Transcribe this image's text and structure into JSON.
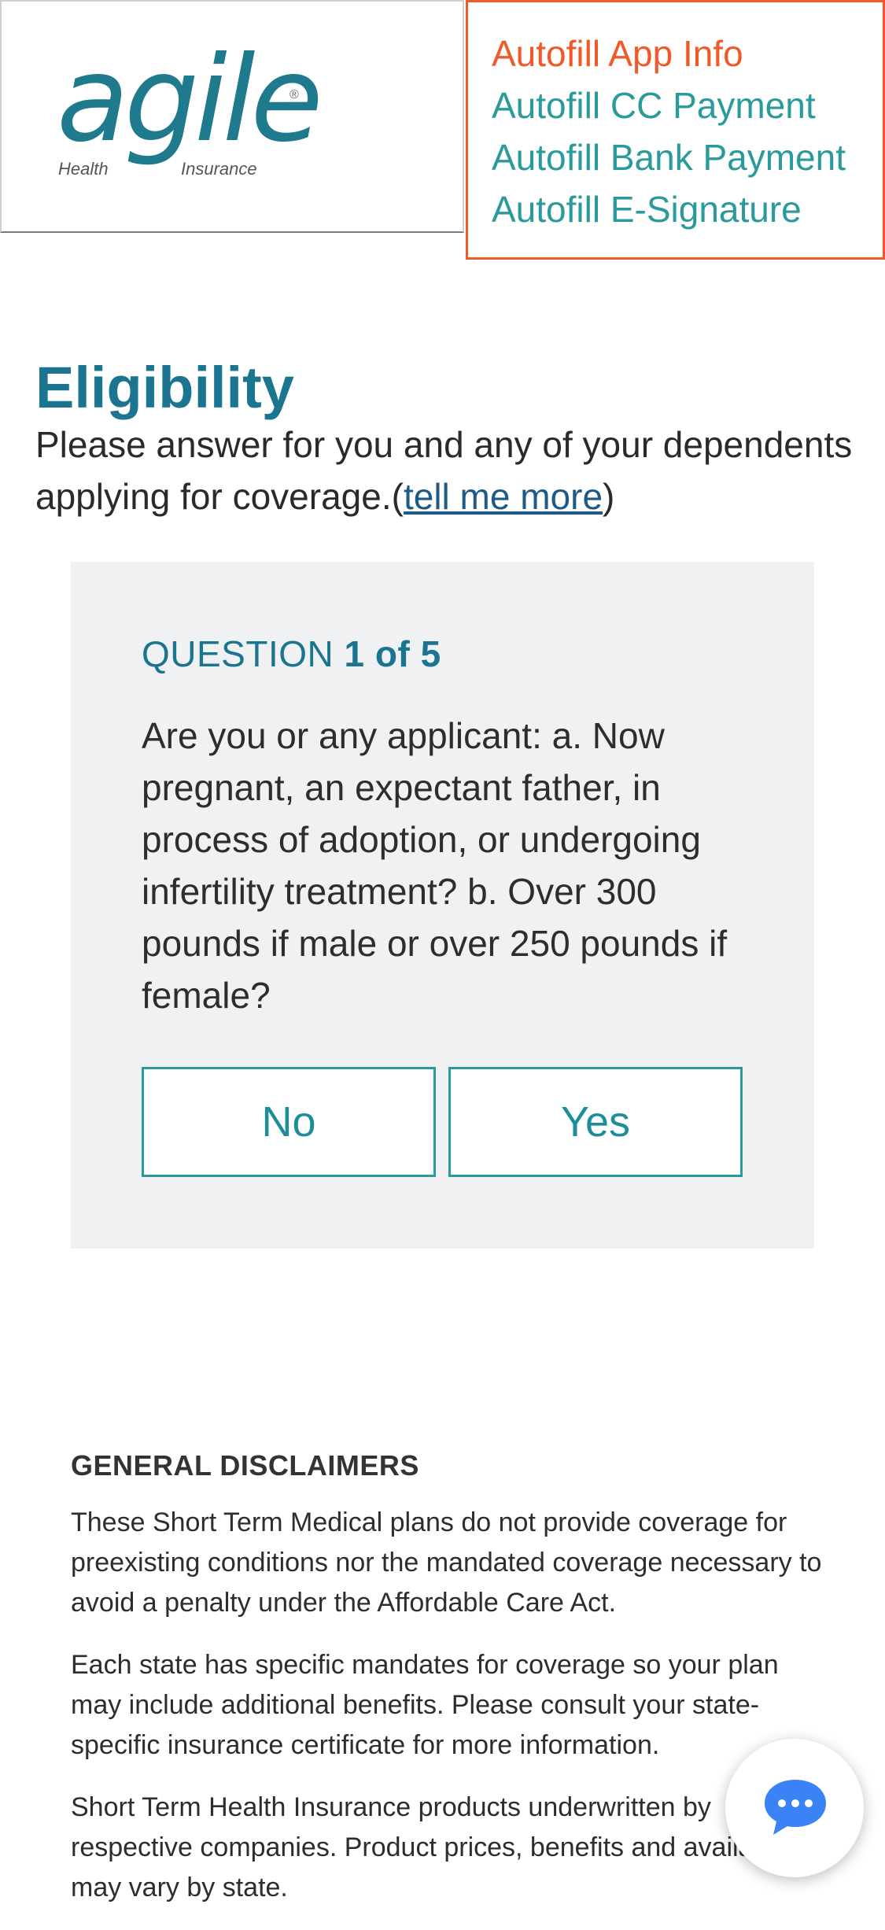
{
  "header": {
    "logo": {
      "word": "agile",
      "left_sub": "Health",
      "right_sub": "Insurance",
      "reg": "®"
    },
    "autofill_links": [
      {
        "label": "Autofill App Info",
        "active": true
      },
      {
        "label": "Autofill CC Payment",
        "active": false
      },
      {
        "label": "Autofill Bank Payment",
        "active": false
      },
      {
        "label": "Autofill E-Signature",
        "active": false
      }
    ]
  },
  "eligibility": {
    "title": "Eligibility",
    "description": "Please answer for you and any of your dependents applying for coverage.",
    "open_paren": "(",
    "more_link": "tell me more",
    "close_paren": ")"
  },
  "question": {
    "label": "QUESTION",
    "counter": "1 of 5",
    "text": "Are you or any applicant: a. Now pregnant, an expectant father, in process of adoption, or undergoing infertility treatment? b. Over 300 pounds if male or over 250 pounds if female?",
    "no_label": "No",
    "yes_label": "Yes"
  },
  "disclaimers": {
    "heading": "GENERAL DISCLAIMERS",
    "paragraphs": [
      "These Short Term Medical plans do not provide coverage for preexisting conditions nor the mandated coverage necessary to avoid a penalty under the Affordable Care Act.",
      "Each state has specific mandates for coverage so your plan may include additional benefits. Please consult your state-specific insurance certificate for more information.",
      "Short Term Health Insurance products underwritten by respective companies. Product prices, benefits and availability may vary by state."
    ]
  },
  "colors": {
    "brand_teal": "#1b7590",
    "link_teal": "#2a9a9a",
    "autofill_active": "#f05a28",
    "chat_blue": "#3b82f6"
  },
  "icons": {
    "chat": "chat-bubble-icon"
  }
}
